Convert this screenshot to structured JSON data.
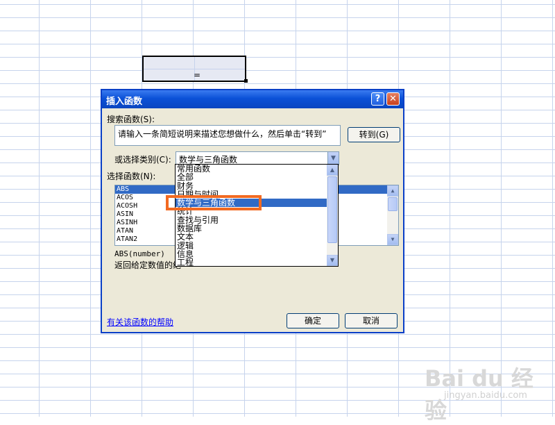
{
  "sheet": {
    "cell_formula": "="
  },
  "dialog": {
    "title": "插入函数",
    "help_btn": "?",
    "close_btn": "✕",
    "search_label": "搜索函数(S):",
    "search_value": "请输入一条简短说明来描述您想做什么，然后单击“转到”",
    "goto_label": "转到(G)",
    "category_label": "或选择类别(C):",
    "category_value": "数学与三角函数",
    "function_label": "选择函数(N):",
    "functions": [
      "ABS",
      "ACOS",
      "ACOSH",
      "ASIN",
      "ASINH",
      "ATAN",
      "ATAN2"
    ],
    "syntax": "ABS(number)",
    "description": "返回给定数值的绝",
    "help_link": "有关该函数的帮助",
    "ok_label": "确定",
    "cancel_label": "取消"
  },
  "dropdown": {
    "options": [
      "常用函数",
      "全部",
      "财务",
      "日期与时间",
      "数学与三角函数",
      "统计",
      "查找与引用",
      "数据库",
      "文本",
      "逻辑",
      "信息",
      "工程"
    ],
    "selected_index": 4
  },
  "watermark": {
    "brand": "Bai du 经验",
    "url": "jingyan.baidu.com"
  },
  "icons": {
    "dropdown_arrow": "chevron-down-icon",
    "scroll_up": "chevron-up-icon",
    "scroll_down": "chevron-down-icon"
  },
  "colors": {
    "titlebar": "#0b51d7",
    "selection": "#316ac5",
    "highlight": "#f26a21"
  }
}
